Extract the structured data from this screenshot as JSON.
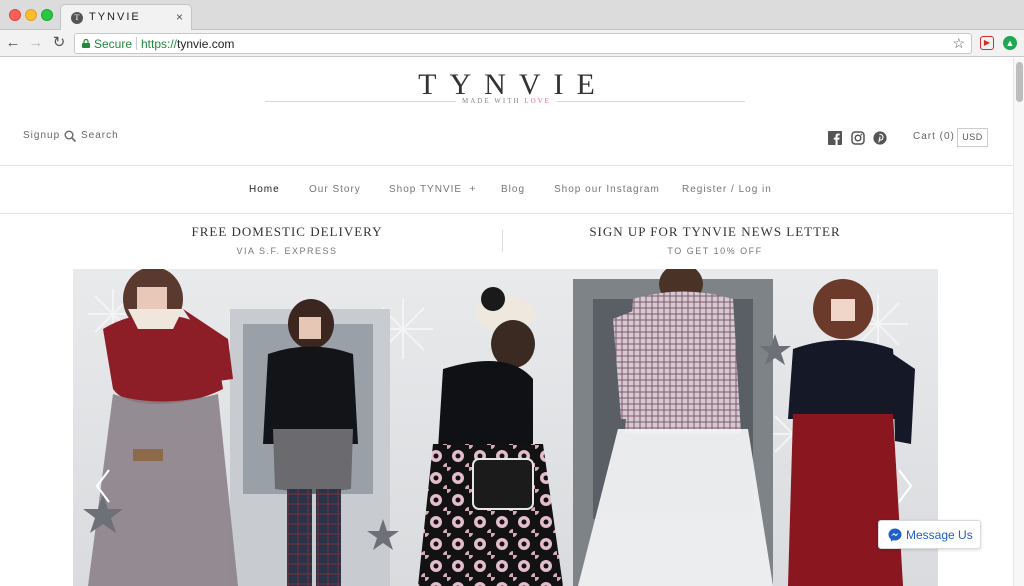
{
  "browser": {
    "tab_title": "TYNVIE",
    "tab_favicon": "T",
    "tab_close": "×",
    "secure_label": "Secure",
    "url_scheme": "https://",
    "url_host": "tynvie.com",
    "icons": [
      "back-icon",
      "forward-icon",
      "reload-icon",
      "lock-icon",
      "star-icon",
      "extension-icon",
      "extension-icon"
    ]
  },
  "site": {
    "logo": "TYNVIE",
    "tagline_a": "MADE WITH ",
    "tagline_b": "LOVE",
    "signup": "Signup",
    "search": "Search",
    "cart": "Cart (0)",
    "currency": "USD"
  },
  "nav": {
    "items": [
      {
        "label": "Home"
      },
      {
        "label": "Our Story"
      },
      {
        "label": "Shop TYNVIE  +"
      },
      {
        "label": "Blog"
      },
      {
        "label": "Shop our Instagram"
      },
      {
        "label": "Register / Log in"
      }
    ]
  },
  "promos": [
    {
      "title": "FREE DOMESTIC DELIVERY",
      "subtitle": "VIA S.F. EXPRESS"
    },
    {
      "title": "SIGN UP FOR TYNVIE NEWS LETTER",
      "subtitle": "TO GET 10% OFF"
    }
  ],
  "messenger": {
    "label": "Message Us"
  },
  "colors": {
    "secure": "#1f8a3b",
    "accent_pink": "#e46a8a",
    "messenger_blue": "#1f5fc9"
  }
}
